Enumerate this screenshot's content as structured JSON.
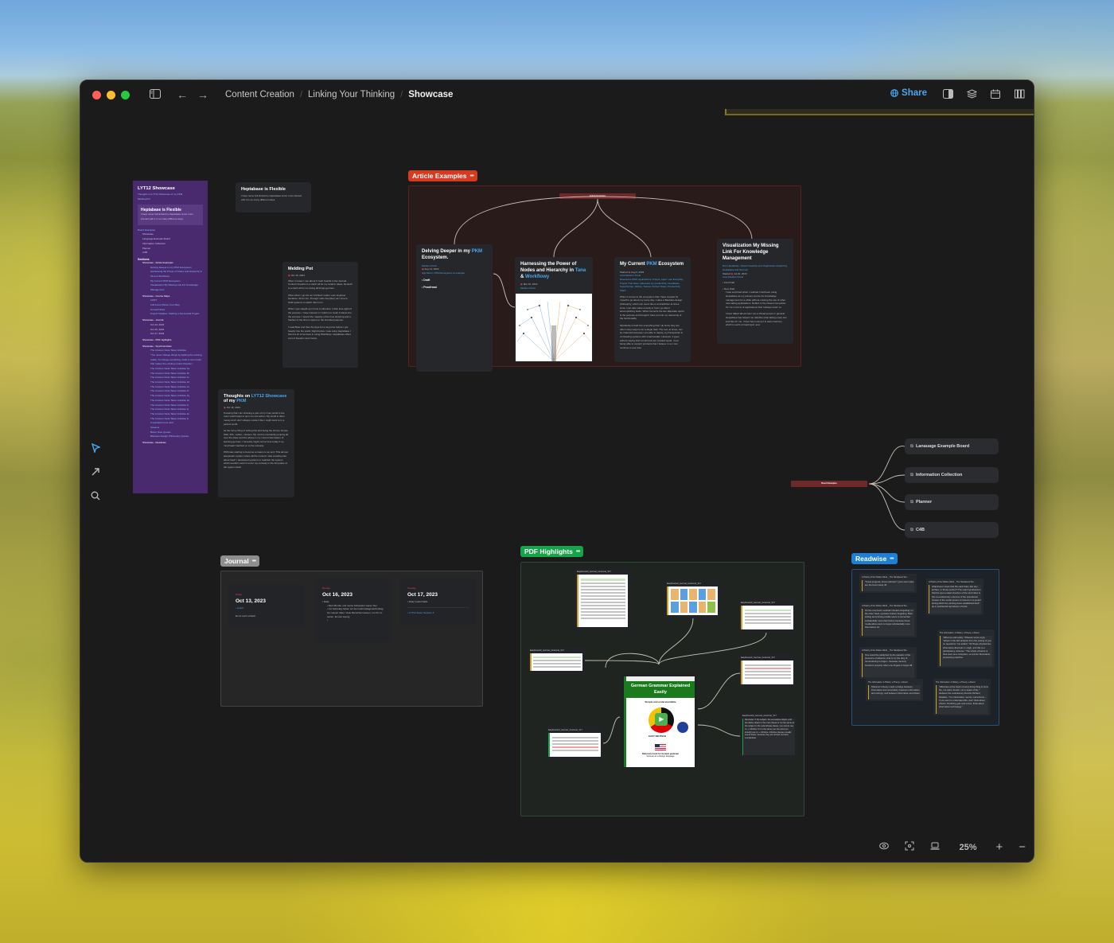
{
  "window": {
    "breadcrumb": [
      "Content Creation",
      "Linking Your Thinking",
      "Showcase"
    ],
    "share_label": "Share",
    "zoom_level": "25%"
  },
  "icons": {
    "sidebar_toggle": "sidebar-icon",
    "back": "←",
    "forward": "→",
    "select": "⮝",
    "arrow": "↗",
    "search": "⌕",
    "globe": "🌐",
    "plus": "+",
    "minus": "−"
  },
  "colors": {
    "accent": "#4aa6f0",
    "article_group": "#d63a1f",
    "journal_group": "#8e8e8e",
    "pdf_group": "#16a34a",
    "readwise_group": "#1e7fd6",
    "board_node": "#6e2a2a"
  },
  "showcase_card": {
    "title": "LYT12 Showcase",
    "subtitle_link": "Thoughts on LYT12 Showcase of my PKM",
    "subtitle_link2": "Melding Pot",
    "inner_title": "Heptabase is Flexible",
    "inner_text": "I have never felt limited by Heptabase since I can interact with it in so many different ways.",
    "board_examples_label": "Board Examples",
    "board_examples": [
      "Showcase",
      "Language Example Board",
      "Information Collection",
      "Planner",
      "C4B"
    ],
    "sections_label": "Sections",
    "sections": [
      {
        "title": "Showcase - Article Examples",
        "items": [
          "Delving Deeper in my PKM Ecosystem",
          "Harnessing the Power of Nodes and Hierarchy in Tana & Workflowy",
          "My Current PKM Ecosystem",
          "Visualization My Missing Link For Knowledge Management"
        ]
      },
      {
        "title": "Showcase - Course Maps",
        "items": [
          "ACRT",
          "Full Focus Planer Cert Map",
          "Cornell Notes",
          "Project Initiation: Starting a Successful Project"
        ]
      },
      {
        "title": "Showcase - Journal",
        "items": [
          "Oct 13, 2023",
          "Oct 16, 2023",
          "Oct 17, 2023"
        ]
      },
      {
        "title": "Showcase - PDF Highlights",
        "items": []
      },
      {
        "title": "Showcase - Synchronicities",
        "items": [
          "The Anxious Node Taken Antidote",
          "\"You never change things by fighting the existing reality. To change something, build a new model that makes the existing model obsolete.\"",
          "The Anxious Node Taken Antidote 1a",
          "The Anxious Node Taken Antidote 1b",
          "The Anxious Node Taken Antidote 1c",
          "The Anxious Node Taken Antidote 1d",
          "The Anxious Node Taken Antidote 1e",
          "The Anxious Node Taken Antidote 1f",
          "The Anxious Node Taken Antidote 1g",
          "The Anxious Node Taken Antidote 1h",
          "The Anxious Node Taken Antidote 1i",
          "The Anxious Node Taken Antidote 1j",
          "The Anxious Node Taken Antidote 1k",
          "The Anxious Node Taken Antidote 1l",
          "A wonderful new card",
          "Streams",
          "Better Note Quotes",
          "Bauhaus Design Philosophy Quotes"
        ]
      },
      {
        "title": "Showcase - Readwise",
        "items": []
      }
    ]
  },
  "heptabase_card": {
    "title": "Heptabase is Flexible",
    "text": "I have never felt limited by Heptabase since I can interact with it in so many different ways."
  },
  "melding_pot": {
    "title": "Melding Pot",
    "date": "Oct 16, 2023",
    "paragraphs": [
      "Often in tower I use about 3 main boards in the Journal. Content Creation is a catch all for my random ideas. Deutsch is a catch all for me doing all things german.",
      "Often when I go into an Architect mode I ever engineer because I find it fun. Though I also feel jittery as I love to build systems to watch them turn.",
      "When I get caught up in how to structure I often lose sight of the purpose. I have interest in I build in to mesh it below into the process. I spend the majority of the time tinkering and a fraction of the time is spent on the intended purpose.",
      "I used Bear and then Anytype for a long time before I got heavily into the world. Right before I was using Heptabase I found a lot of success in using Workflowy. Heptabase offers a lot of freedom and choice."
    ]
  },
  "thoughts_card": {
    "title_parts": [
      "Thoughts on ",
      "LYT12 Showcase",
      " of my ",
      "PKM"
    ],
    "date": "Oct 16, 2023",
    "paragraphs": [
      "Knowing that I am showing a part of my inner world to the outer world helps to spur me into action. My world is often messy and I don't always curate it like I might want to in a perfect world.",
      "Its the funny thing of writing this and being the shows, knows, Well, XPL, wollen, müssen. My mind is constantly jumping all over the place and the above is my current fascination of learning german. I honestly might not be here today if my mind hadn't latched on to the curiosity.",
      "PKM was starting to become a means to an end. This almost autopoietic system where all the content I was creating was about itself. I developed systems to maintain the system which wouldn't exist if not for my curiosity in the first place of the system itself."
    ]
  },
  "article_examples": {
    "label": "Article Examples",
    "root_node": "Article Examples",
    "cards": [
      {
        "title_parts": [
          "Delving Deeper in my ",
          "PKM",
          " Ecosystem."
        ],
        "source": "Medium Posts",
        "date": "Aug 14, 2023",
        "meta": "App Mesh • PKM Ecosystem AI example",
        "bullets": [
          "Draft",
          "Proofread"
        ]
      },
      {
        "title_parts": [
          "Harnessing the Power of Nodes and Hierarchy in ",
          "Tana",
          " & ",
          "Workflowy"
        ],
        "date": "Mar 16, 2023",
        "source": "Medium Posts"
      },
      {
        "title_parts": [
          "My Current ",
          "PKM",
          " Ecosystem"
        ],
        "started": "Started",
        "date": "Aug 6, 2023",
        "source": "Area Medium Posts",
        "meta": "Resources PKM, Applications, 8 Apps, Apps I use Everyday, 8 Apps That Have Upleveled my productivity, Heptabase, Superhuman, Rclfow, Todoist, Perfect Notes, Productivity Stack",
        "paragraphs": [
          "When it comes to the ecosystem that I have created for myself to go about my every day, I value a Bauhaus design philosophy, which can seem like a contradiction at times since I can also value novelty in how I go about accomplishing tasks. What connects the two disparate topics is the purpose and thought I have put into my reasoning of the functionality.",
          "Modularity is built into everything that I do since they are often many ways to do a single task. The tool, at times, can be irrelevant because I am able to deploy my frameworks in contrasting systems with small tweaks. However, it goes without saying that not all tools are created equal. I love being able to support products that I believe in so I can continue to use how."
        ]
      },
      {
        "title": "Visualization My Missing Link For Knowledge Management",
        "ref": "Ref: Heptabase, Visual Creativity and Organization Exploring Heptabase and Scrivner",
        "started": "Started",
        "date": "Jul 23, 2023",
        "source": "Area Medium Posts",
        "bullets": [
          "First Draft",
          "New Draft"
        ],
        "paragraphs": [
          "I was surprised when I realized I had been using Heptabase as my primary source for knowledge management for a while without missing the use of other note taking applications. Reflect is the closest competitor for me in terms of applications that I always return to.",
          "I have talked about how I am a Visual person in general. Heptabase has helped me redefine what taking notes can look like for me. I have been using it to learn German, which is such a broad topic, and"
        ]
      }
    ]
  },
  "board_examples": {
    "root_node": "Board Examples",
    "items": [
      "Lanauage Example Board",
      "Information Collection",
      "Planner",
      "C4B"
    ]
  },
  "journal": {
    "label": "Journal",
    "cards": [
      {
        "weekday": "Friday",
        "date": "Oct 13, 2023",
        "bullets": [
          "Leach"
        ],
        "text": "Es ist auch einfach."
      },
      {
        "weekday": "Monday",
        "date": "Oct 16, 2023",
        "bullets": [
          "Daily"
        ],
        "sub": [
          "Mein Bruder und meine Schwester waren hier.",
          "Am Samstag hatten wir den Geburtstagsnachmittag für meinen Vater. Viele Menschen kamen, um ihn zu sehen. Es war traurig.",
          ""
        ]
      },
      {
        "weekday": "Tuesday",
        "date": "Oct 17, 2023",
        "bullets": [
          "Daily Guard Rails",
          "LYT12 Super Session 4"
        ]
      }
    ]
  },
  "pdf_highlights": {
    "label": "PDF Highlights",
    "source_name": "EasyDeutsch_German_Grammar_V17",
    "book": {
      "title": "German Grammar Explained Easily",
      "subtitle": "Simple and understandable",
      "brand": "EASY DEUTSCH",
      "footer1": "Reference book for German grammar",
      "footer2": "German as a foreign language"
    },
    "note_text": "Reminder: If the subject, the accusative object, and the dative object in the main clause is not the same as the subject in the subordinate clause, you cannot use zu + infinitive. If it is the same you can (and you should) use zu + infinitive. Infinitive clauses usually sound better, because they are shorter and less complicated."
  },
  "readwise": {
    "label": "Readwise",
    "cards": [
      {
        "source": "A History of the Written Word _ The Handpress Wo...",
        "quote": "\"Know progress, know optimism\" (your own notes are the best notes) 33"
      },
      {
        "source": "A History of the Written Word _ The Handpress Wo...",
        "quote": "what does it mean that the card index, like any archive, is 'future-centric'? The main hypothesis is that the open-ended structure of the card index is the co-evolutionary outcome of the operational closure of the social system of science in a period during which the printing press established itself as a mechanical reproducer of texts."
      },
      {
        "source": "A History of the Written Word _ The Handpress Wo...",
        "quote": "On the one hand, evolution hinders forgetting; on the other hand, evolution fosters forgetting. Both writing and printing enable users to remember substantially more than before because these media allow users to forget substantially more than before 44"
      },
      {
        "source": "The Information: A History, a Theory, a Flood",
        "quote": "\"What we call reality,\" Wheeler wrote coyly, \"arises in the last analysis from the posing of yes-no questions.\" He added: \"All things physical are information-theoretic in origin, and this is a participatory universe.\" The whole universe is thus seen as a computer—a cosmic information-processing machine."
      },
      {
        "source": "A History of the Written Word _ The Handpress Wo...",
        "quote": "One would be paralyzed by the paradox of the presence of absence, that is, by the duty of remembering to forget – because memory functions properly when one forgets to forget 49"
      },
      {
        "source": "The Information: A History, a Theory, a Flood",
        "quote": "Shannon's theory made a bridge between information and uncertainty; between information and entropy; and between information and chaos."
      },
      {
        "source": "The Information: A History, a Theory, a Flood",
        "quote": "\"What lies at the heart of every living thing is not a fire, not warm breath, not a 'spark of life,'\" declares the evolutionary theorist Richard Dawkins. \"It is information, words, instructions.... If you want to understand life, don't think about vibrant, throbbing gels and oozes, think about information technology.\""
      }
    ]
  }
}
